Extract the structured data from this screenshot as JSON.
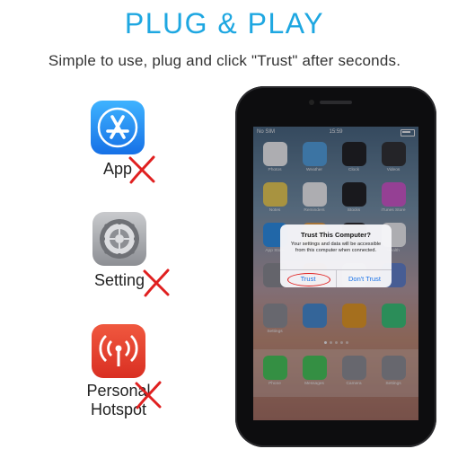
{
  "header": {
    "title": "PLUG & PLAY",
    "subtitle": "Simple to use, plug and click \"Trust\" after seconds."
  },
  "features": [
    {
      "label": "App",
      "icon": "app-store-icon",
      "status": "not-required"
    },
    {
      "label": "Setting",
      "icon": "settings-gear-icon",
      "status": "not-required"
    },
    {
      "label": "Personal\nHotspot",
      "label_line1": "Personal",
      "label_line2": "Hotspot",
      "icon": "hotspot-icon",
      "status": "not-required"
    }
  ],
  "phone": {
    "status_bar": {
      "carrier": "No SIM",
      "time": "15:59"
    },
    "apps": [
      {
        "label": "Photos",
        "color": "#ffffff"
      },
      {
        "label": "Weather",
        "color": "#4aa3e8"
      },
      {
        "label": "Clock",
        "color": "#111111"
      },
      {
        "label": "Videos",
        "color": "#222222"
      },
      {
        "label": "Notes",
        "color": "#f7d54a"
      },
      {
        "label": "Reminders",
        "color": "#ffffff"
      },
      {
        "label": "Stocks",
        "color": "#111111"
      },
      {
        "label": "iTunes Store",
        "color": "#d84fd0"
      },
      {
        "label": "App Store",
        "color": "#1d8ef0"
      },
      {
        "label": "Home",
        "color": "#f3a33a"
      },
      {
        "label": "Wallet",
        "color": "#1a1a1a"
      },
      {
        "label": "Health",
        "color": "#ffffff"
      },
      {
        "label": "",
        "color": "#8a8a8e"
      },
      {
        "label": "",
        "color": "#e54b3c"
      },
      {
        "label": "",
        "color": "#f0f0f0"
      },
      {
        "label": "",
        "color": "#5b7fd0"
      },
      {
        "label": "Settings",
        "color": "#8e8e93"
      },
      {
        "label": "",
        "color": "#3c8bd9"
      },
      {
        "label": "",
        "color": "#f39c12"
      },
      {
        "label": "",
        "color": "#2ecc71"
      }
    ],
    "dock": [
      {
        "label": "Phone",
        "color": "#3ccf4e"
      },
      {
        "label": "Messages",
        "color": "#3ccf4e"
      },
      {
        "label": "Camera",
        "color": "#8e8e93"
      },
      {
        "label": "Settings",
        "color": "#8e8e93"
      }
    ],
    "dialog": {
      "title": "Trust This Computer?",
      "body": "Your settings and data will be accessible from this computer when connected.",
      "trust_label": "Trust",
      "dont_trust_label": "Don't Trust"
    }
  },
  "colors": {
    "accent": "#1ea7e1",
    "cross": "#e02020",
    "link": "#1a73e8"
  }
}
